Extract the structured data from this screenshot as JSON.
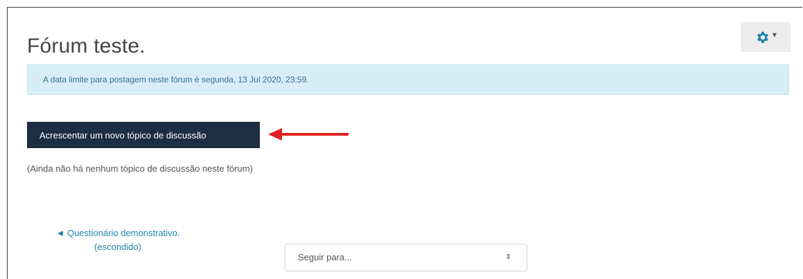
{
  "page": {
    "title": "Fórum teste."
  },
  "settings_menu": {
    "icon": "gear-icon",
    "caret": "▾",
    "accent": "#1f84a8"
  },
  "alert": {
    "text": "A data limite para postagem neste fórum é segunda, 13 Jul 2020, 23:59."
  },
  "actions": {
    "add_discussion_label": "Acrescentar um novo tópico de discussão",
    "button_color": "#1d2e42",
    "annotation_arrow_color": "#e02020"
  },
  "discussions": {
    "empty_message": "(Ainda não há nenhum tópico de discussão neste fórum)"
  },
  "navigation": {
    "prev_activity_arrow": "◄",
    "prev_activity_name": "Questionário demonstrativo.",
    "prev_activity_status": "(escondido)",
    "jump_to_placeholder": "Seguir para...",
    "jump_to_caret": "⇕"
  }
}
